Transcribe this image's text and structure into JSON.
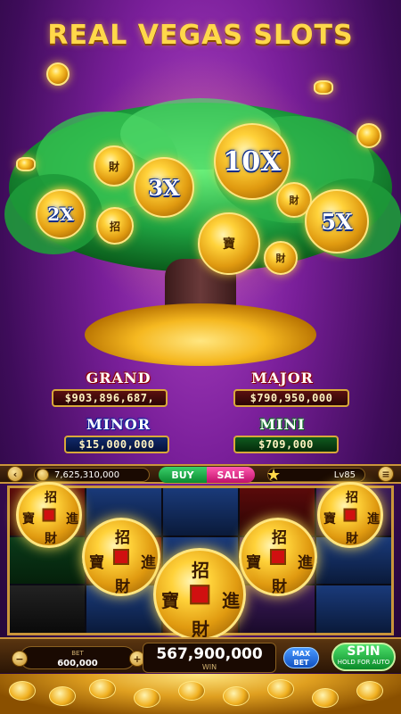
{
  "title": "REAL VEGAS SLOTS",
  "multipliers": [
    "2X",
    "3X",
    "10X",
    "5X"
  ],
  "jackpots": {
    "grand": {
      "label": "GRAND",
      "amount": "$903,896,687,"
    },
    "major": {
      "label": "MAJOR",
      "amount": "$790,950,000"
    },
    "minor": {
      "label": "MINOR",
      "amount": "$15,000,000"
    },
    "mini": {
      "label": "MINI",
      "amount": "$709,000"
    }
  },
  "top_bar": {
    "balance": "7,625,310,000",
    "buy_label": "BUY",
    "sale_label": "SALE",
    "level": "Lv85"
  },
  "coin_chars": {
    "top": "招",
    "left": "寶",
    "right": "進",
    "bottom": "財"
  },
  "bottom_bar": {
    "bet_label": "BET",
    "bet_value": "600,000",
    "win_value": "567,900,000",
    "win_label": "WIN",
    "max_bet_line1": "MAX",
    "max_bet_line2": "BET",
    "spin_label": "SPIN",
    "spin_sub": "HOLD FOR AUTO"
  },
  "colors": {
    "gold": "#ffd84a",
    "purple": "#7a1f9a",
    "spin_green": "#0a8a2a",
    "maxbet_blue": "#1050c0"
  }
}
